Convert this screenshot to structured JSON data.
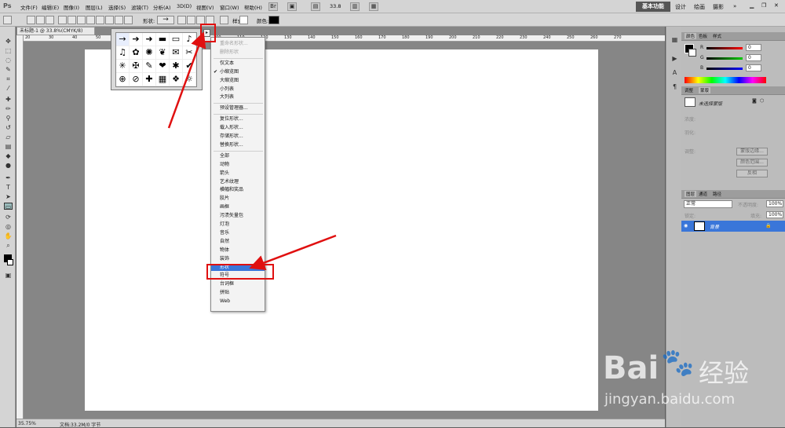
{
  "app": {
    "logo": "Ps"
  },
  "menubar": {
    "items": [
      "文件(F)",
      "编辑(E)",
      "图像(I)",
      "图层(L)",
      "选择(S)",
      "滤镜(T)",
      "分析(A)",
      "3D(D)",
      "视图(V)",
      "窗口(W)",
      "帮助(H)"
    ],
    "zoom": "33.8",
    "workspace_active": "基本功能",
    "workspaces": [
      "设计",
      "绘画",
      "摄影"
    ]
  },
  "options": {
    "shape_label": "形状:",
    "style_label": "样式:",
    "color_label": "颜色:"
  },
  "document": {
    "tab_title": "未标题-1 @ 33.8%(CMYK/8)",
    "ruler_marks": [
      "20",
      "30",
      "40",
      "50",
      "60",
      "70",
      "80",
      "90",
      "100",
      "110",
      "120",
      "130",
      "140",
      "150",
      "160",
      "170",
      "180",
      "190",
      "200",
      "210",
      "220",
      "230",
      "240",
      "250",
      "260",
      "270"
    ],
    "status_zoom": "35.75%",
    "status_doc": "文档:33.2M/0 字节"
  },
  "shape_picker": {
    "shapes": [
      "→",
      "➔",
      "➜",
      "▬",
      "▭",
      "♪",
      "♫",
      "✿",
      "✺",
      "❦",
      "✉",
      "✂",
      "✳",
      "✠",
      "✎",
      "❤",
      "✱",
      "✔",
      "⊕",
      "⊘",
      "✚",
      "▦",
      "❖",
      "☼"
    ]
  },
  "flyout_menu": {
    "items": [
      {
        "label": "重命名形状...",
        "disabled": true
      },
      {
        "label": "删除形状",
        "disabled": true
      },
      {
        "sep": true
      },
      {
        "label": "仅文本"
      },
      {
        "label": "小缩览图",
        "checked": true
      },
      {
        "label": "大缩览图"
      },
      {
        "label": "小列表"
      },
      {
        "label": "大列表"
      },
      {
        "sep": true
      },
      {
        "label": "预设管理器..."
      },
      {
        "sep": true
      },
      {
        "label": "复位形状..."
      },
      {
        "label": "载入形状..."
      },
      {
        "label": "存储形状..."
      },
      {
        "label": "替换形状..."
      },
      {
        "sep": true
      },
      {
        "label": "全部"
      },
      {
        "label": "动物"
      },
      {
        "label": "箭头"
      },
      {
        "label": "艺术纹理"
      },
      {
        "label": "横幅和奖品"
      },
      {
        "label": "胶片"
      },
      {
        "label": "画框"
      },
      {
        "label": "污渍矢量包"
      },
      {
        "label": "灯泡"
      },
      {
        "label": "音乐"
      },
      {
        "label": "自然"
      },
      {
        "label": "物体"
      },
      {
        "label": "装饰"
      },
      {
        "label": "形状",
        "selected": true
      },
      {
        "label": "符号"
      },
      {
        "label": "台词框"
      },
      {
        "label": "拼贴"
      },
      {
        "label": "Web"
      }
    ]
  },
  "color_panel": {
    "tabs": [
      "颜色",
      "色板",
      "样式"
    ],
    "channels": [
      {
        "name": "R",
        "value": "0"
      },
      {
        "name": "G",
        "value": "0"
      },
      {
        "name": "B",
        "value": "0"
      }
    ]
  },
  "adjust_panel": {
    "tabs": [
      "调整",
      "蒙版"
    ],
    "title": "未选择蒙版",
    "density": "浓度:",
    "feather": "羽化:",
    "refine": "调整:",
    "buttons": [
      "蒙版边缘...",
      "颜色范围...",
      "反相"
    ]
  },
  "layers_panel": {
    "tabs": [
      "图层",
      "通道",
      "路径"
    ],
    "blend": "正常",
    "opacity_label": "不透明度:",
    "opacity": "100%",
    "lock_label": "锁定:",
    "fill_label": "填充:",
    "fill": "100%",
    "layers": [
      {
        "name": "背景"
      }
    ]
  },
  "watermark": {
    "brand": "Bai",
    "brand2": "经验",
    "url": "jingyan.baidu.com"
  },
  "colors": {
    "highlight": "#e01010",
    "selection": "#3a76d9"
  }
}
